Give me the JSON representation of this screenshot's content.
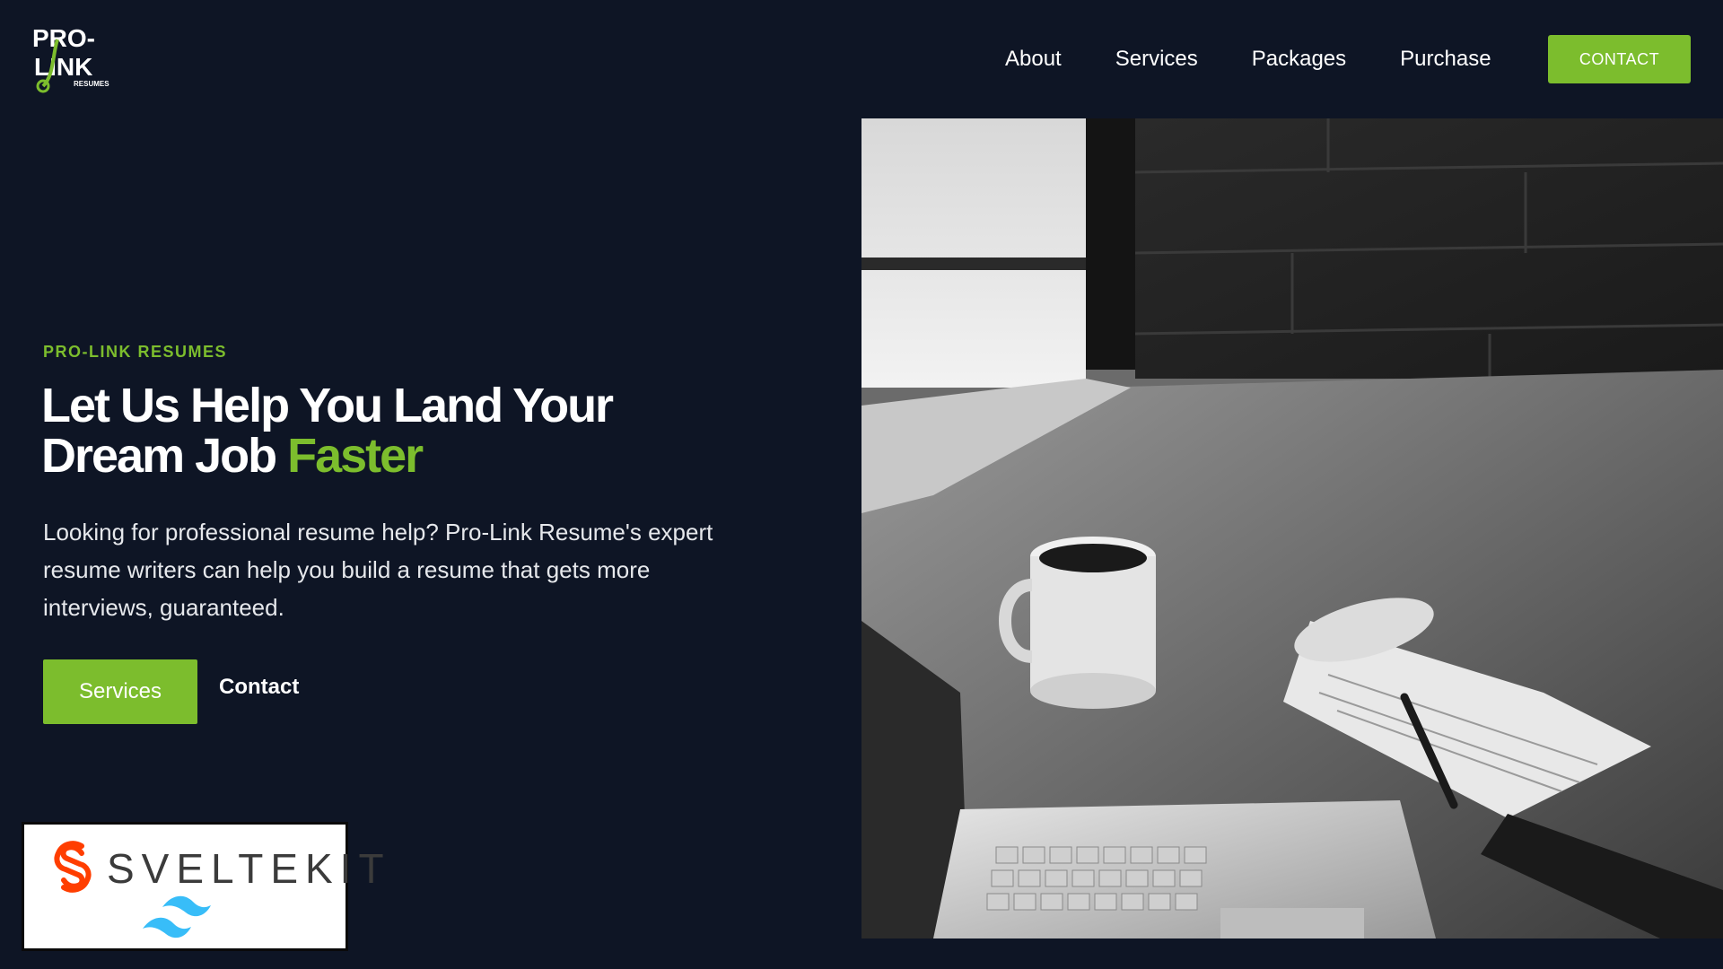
{
  "brand": {
    "logo_line1": "PRO-",
    "logo_line2": "LINK",
    "logo_sub": "RESUMES",
    "accent_color": "#7cbd2d",
    "background_color": "#0e1525"
  },
  "nav": {
    "items": [
      {
        "label": "About"
      },
      {
        "label": "Services"
      },
      {
        "label": "Packages"
      },
      {
        "label": "Purchase"
      }
    ],
    "contact_label": "CONTACT"
  },
  "hero": {
    "eyebrow": "PRO-LINK RESUMES",
    "headline_main": "Let Us Help You Land Your Dream Job ",
    "headline_accent": "Faster",
    "description": "Looking for professional resume help? Pro-Link Resume's expert resume writers can help you build a resume that gets more interviews, guaranteed.",
    "primary_button": "Services",
    "secondary_link": "Contact",
    "image_icon": "desk-laptop-coffee-photo"
  },
  "badge": {
    "text_main": "SVELTE",
    "text_kit": "KIT",
    "svelte_icon": "svelte-logo-icon",
    "tailwind_icon": "tailwind-logo-icon",
    "svelte_color": "#ff3e00",
    "tailwind_color": "#38bdf8"
  }
}
